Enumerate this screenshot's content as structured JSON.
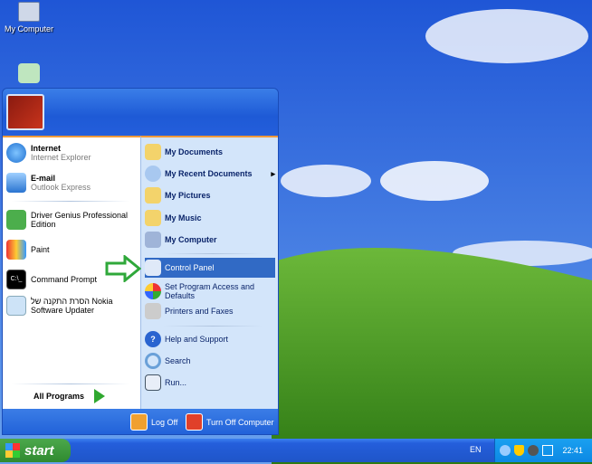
{
  "desktop": {
    "icons": [
      {
        "label": "My Computer"
      },
      {
        "label": ""
      }
    ]
  },
  "start_menu": {
    "pinned": [
      {
        "title": "Internet",
        "subtitle": "Internet Explorer"
      },
      {
        "title": "E-mail",
        "subtitle": "Outlook Express"
      }
    ],
    "recent": [
      {
        "label": "Driver Genius Professional Edition"
      },
      {
        "label": "Paint"
      },
      {
        "label": "Command Prompt"
      },
      {
        "label": "הסרת התקנה של Nokia Software Updater"
      }
    ],
    "all_programs": "All Programs",
    "places": [
      {
        "label": "My Documents"
      },
      {
        "label": "My Recent Documents",
        "arrow": "▸"
      },
      {
        "label": "My Pictures"
      },
      {
        "label": "My Music"
      },
      {
        "label": "My Computer"
      }
    ],
    "settings": [
      {
        "label": "Control Panel"
      },
      {
        "label": "Set Program Access and Defaults"
      },
      {
        "label": "Printers and Faxes"
      }
    ],
    "tools": [
      {
        "label": "Help and Support"
      },
      {
        "label": "Search"
      },
      {
        "label": "Run..."
      }
    ],
    "log_off": "Log Off",
    "turn_off": "Turn Off Computer"
  },
  "taskbar": {
    "start": "start",
    "language": "EN",
    "clock": "22:41"
  }
}
